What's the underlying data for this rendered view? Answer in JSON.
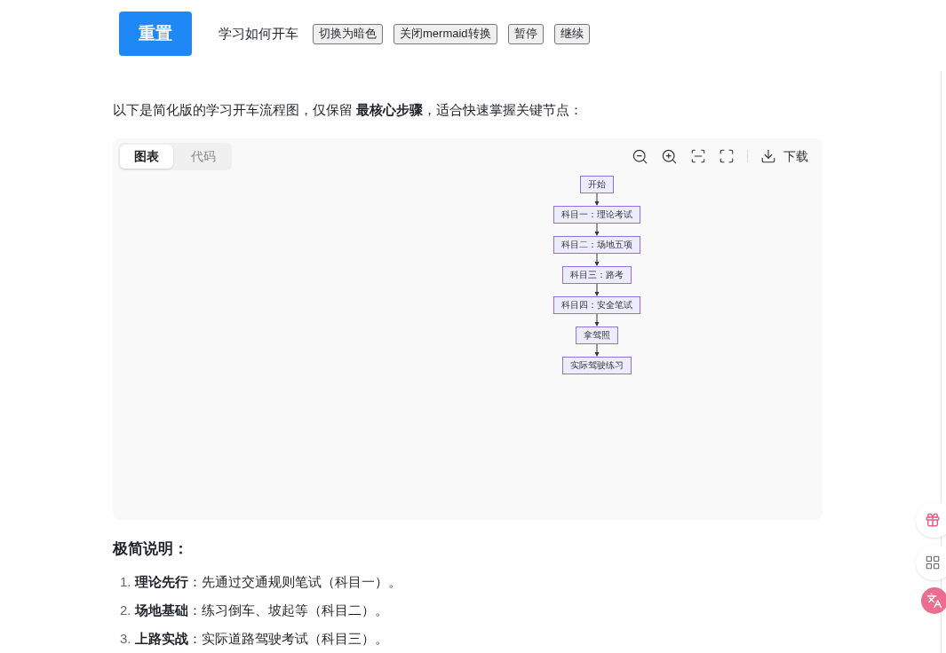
{
  "toolbar": {
    "reset_button": "重置",
    "title": "学习如何开车",
    "buttons": [
      "切换为暗色",
      "关闭mermaid转换",
      "暂停",
      "继续"
    ]
  },
  "intro": "以下是简化版的学习开车流程图，仅保留 **最核心步骤**，适合快速掌握关键节点：",
  "diagram": {
    "tabs": [
      {
        "label": "图表",
        "selected": true
      },
      {
        "label": "代码",
        "selected": false
      }
    ],
    "download": "下载",
    "nodes": [
      "开始",
      "科目一：理论考试",
      "科目二：场地五项",
      "科目三：路考",
      "科目四：安全笔试",
      "拿驾照",
      "实际驾驶练习"
    ]
  },
  "notes": {
    "heading": "极简说明：",
    "items": [
      {
        "number": "1.",
        "term": "理论先行",
        "text": "：先通过交通规则笔试（科目一）。"
      },
      {
        "number": "2.",
        "term": "场地基础",
        "text": "：练习倒车、坡起等（科目二）。"
      },
      {
        "number": "3.",
        "term": "上路实战",
        "text": "：实际道路驾驶考试（科目三）。"
      }
    ]
  }
}
